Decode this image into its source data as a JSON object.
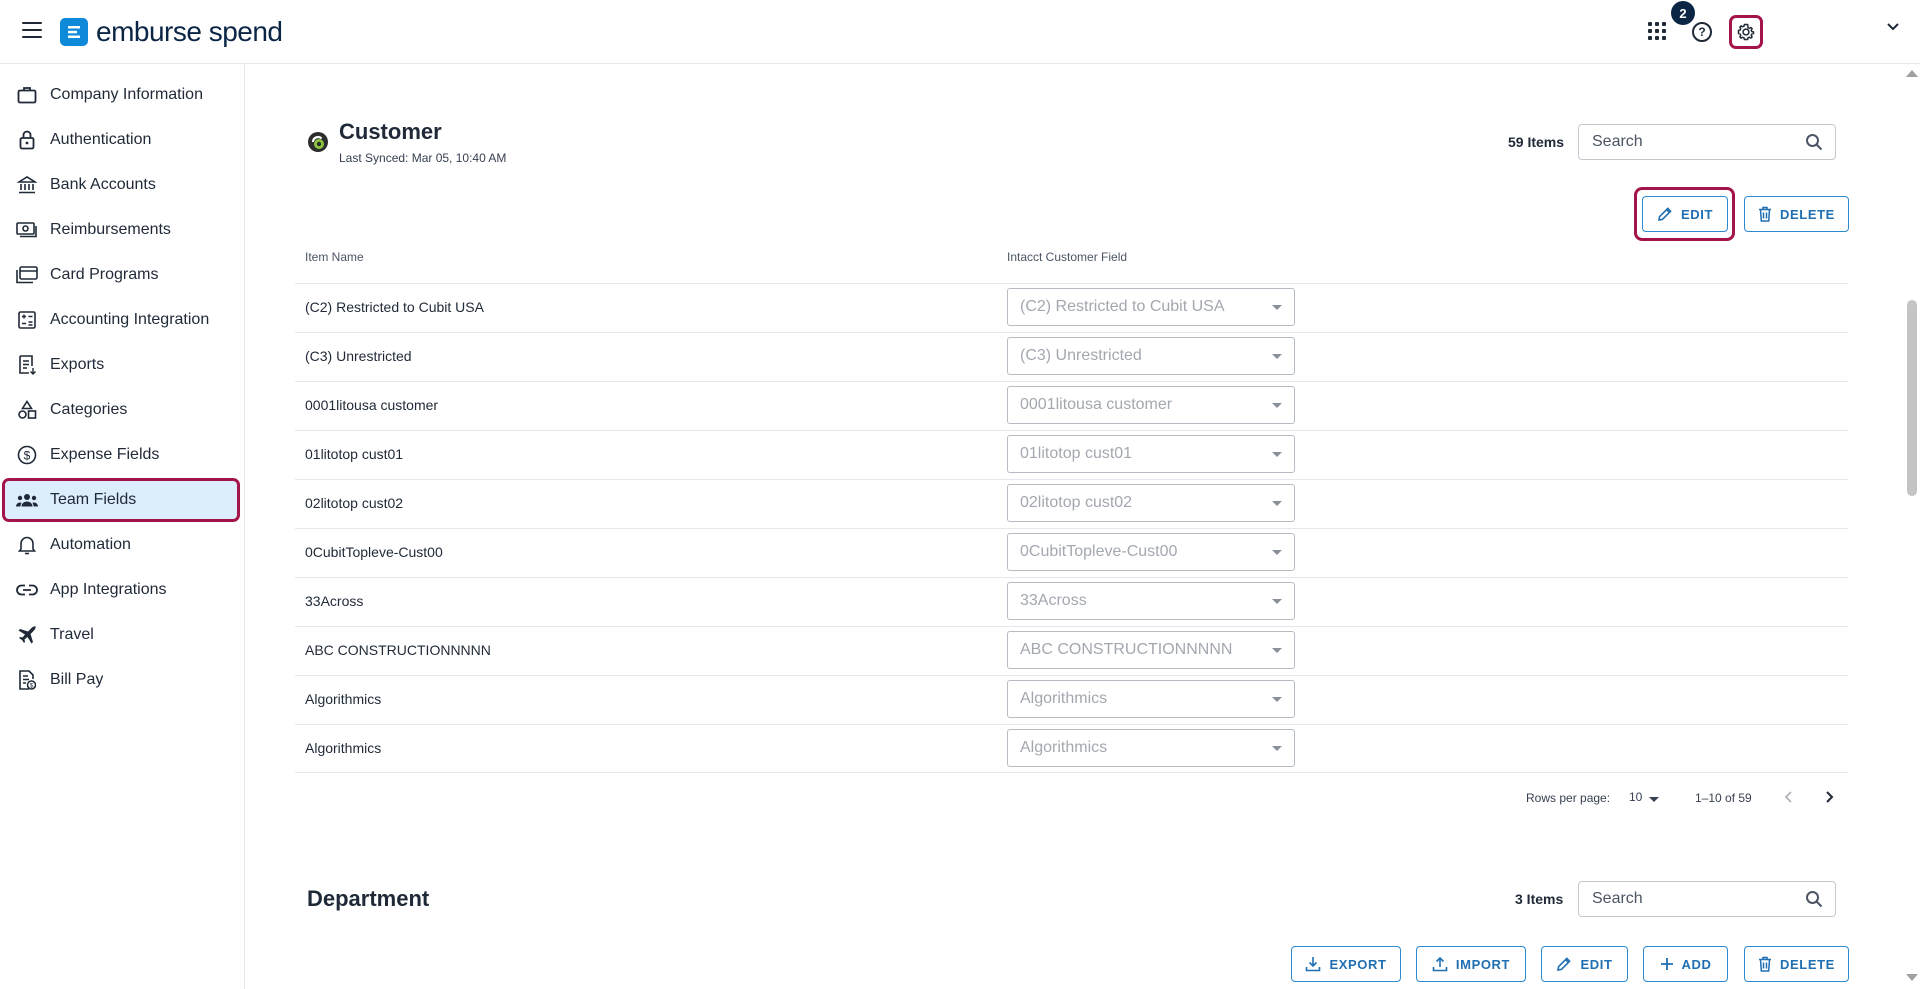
{
  "app": {
    "logo_text": "emburse spend",
    "notifications_count": "2"
  },
  "sidebar": {
    "items": [
      {
        "label": "Company Information",
        "icon": "briefcase-icon"
      },
      {
        "label": "Authentication",
        "icon": "lock-icon"
      },
      {
        "label": "Bank Accounts",
        "icon": "bank-icon"
      },
      {
        "label": "Reimbursements",
        "icon": "cash-icon"
      },
      {
        "label": "Card Programs",
        "icon": "cards-icon"
      },
      {
        "label": "Accounting Integration",
        "icon": "calculator-icon"
      },
      {
        "label": "Exports",
        "icon": "export-doc-icon"
      },
      {
        "label": "Categories",
        "icon": "shapes-icon"
      },
      {
        "label": "Expense Fields",
        "icon": "dollar-circle-icon"
      },
      {
        "label": "Team Fields",
        "icon": "team-icon",
        "active": true
      },
      {
        "label": "Automation",
        "icon": "bell-icon"
      },
      {
        "label": "App Integrations",
        "icon": "link-icon"
      },
      {
        "label": "Travel",
        "icon": "airplane-icon"
      },
      {
        "label": "Bill Pay",
        "icon": "bill-icon"
      }
    ]
  },
  "customer": {
    "title": "Customer",
    "last_synced": "Last Synced: Mar 05, 10:40 AM",
    "count": "59 Items",
    "search_placeholder": "Search",
    "edit_label": "EDIT",
    "delete_label": "DELETE",
    "columns": [
      "Item Name",
      "Intacct Customer Field"
    ],
    "rows": [
      {
        "name": "(C2) Restricted to Cubit USA",
        "field": "(C2) Restricted to Cubit USA"
      },
      {
        "name": "(C3) Unrestricted",
        "field": "(C3) Unrestricted"
      },
      {
        "name": "0001litousa customer",
        "field": "0001litousa customer"
      },
      {
        "name": "01litotop cust01",
        "field": "01litotop cust01"
      },
      {
        "name": "02litotop cust02",
        "field": "02litotop cust02"
      },
      {
        "name": "0CubitTopleve-Cust00",
        "field": "0CubitTopleve-Cust00"
      },
      {
        "name": "33Across",
        "field": "33Across"
      },
      {
        "name": "ABC CONSTRUCTIONNNNN",
        "field": "ABC CONSTRUCTIONNNNN"
      },
      {
        "name": "Algorithmics",
        "field": "Algorithmics"
      },
      {
        "name": "Algorithmics",
        "field": "Algorithmics"
      }
    ],
    "pagination": {
      "rows_per_page_label": "Rows per page:",
      "rows_per_page": "10",
      "range": "1–10 of 59"
    }
  },
  "department": {
    "title": "Department",
    "count": "3 Items",
    "search_placeholder": "Search",
    "buttons": {
      "export": "EXPORT",
      "import": "IMPORT",
      "edit": "EDIT",
      "add": "ADD",
      "delete": "DELETE"
    }
  },
  "colors": {
    "accent": "#1f6fb2",
    "highlight": "#a3154a",
    "active_bg": "#dceefb",
    "brand": "#0f8ad8"
  }
}
